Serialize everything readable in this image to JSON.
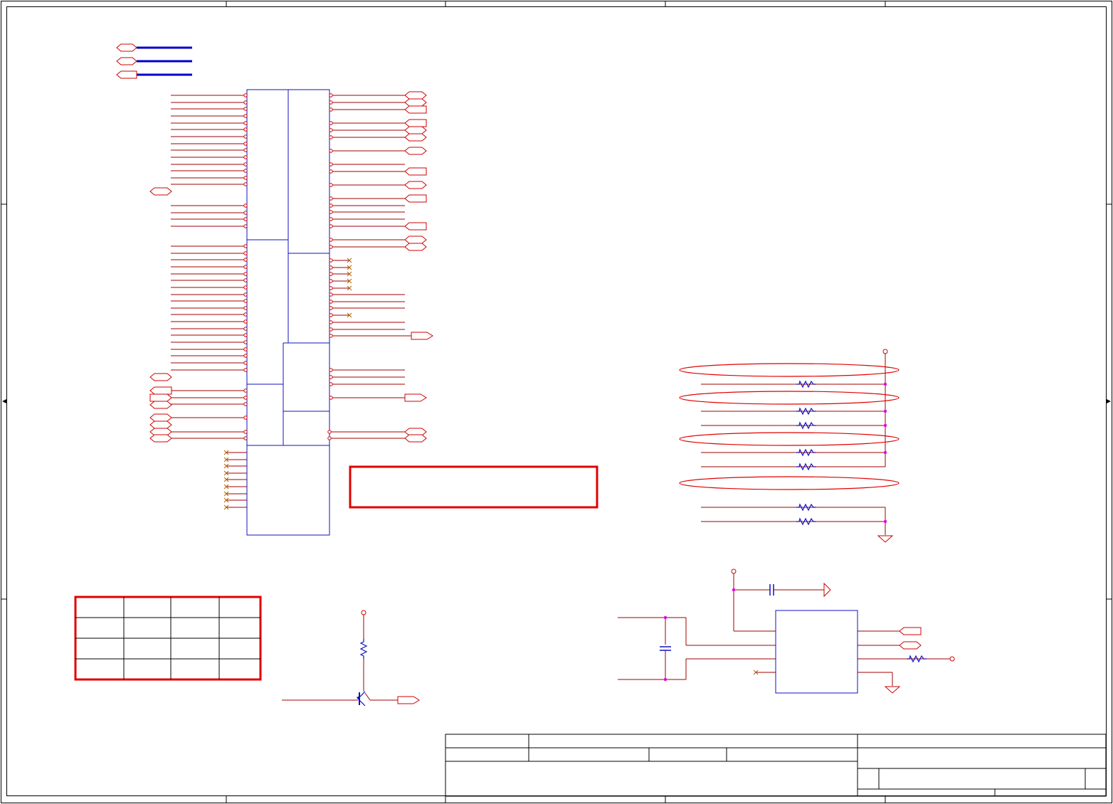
{
  "sheet": {
    "title": "",
    "colors": {
      "border": "#000000",
      "wire_red": "#a00000",
      "bus_blue": "#0000c8",
      "part_red": "#d00000",
      "box_blue": "#1010c0",
      "junction": "#e000e0",
      "noconnect": "#b06000",
      "highlight": "#e00000"
    }
  },
  "icons": {
    "resistor": "resistor-icon",
    "capacitor": "capacitor-icon",
    "ground": "ground-icon",
    "transistor": "npn-transistor-icon",
    "offpage": "off-page-connector-icon",
    "noconnect": "no-connect-icon"
  }
}
